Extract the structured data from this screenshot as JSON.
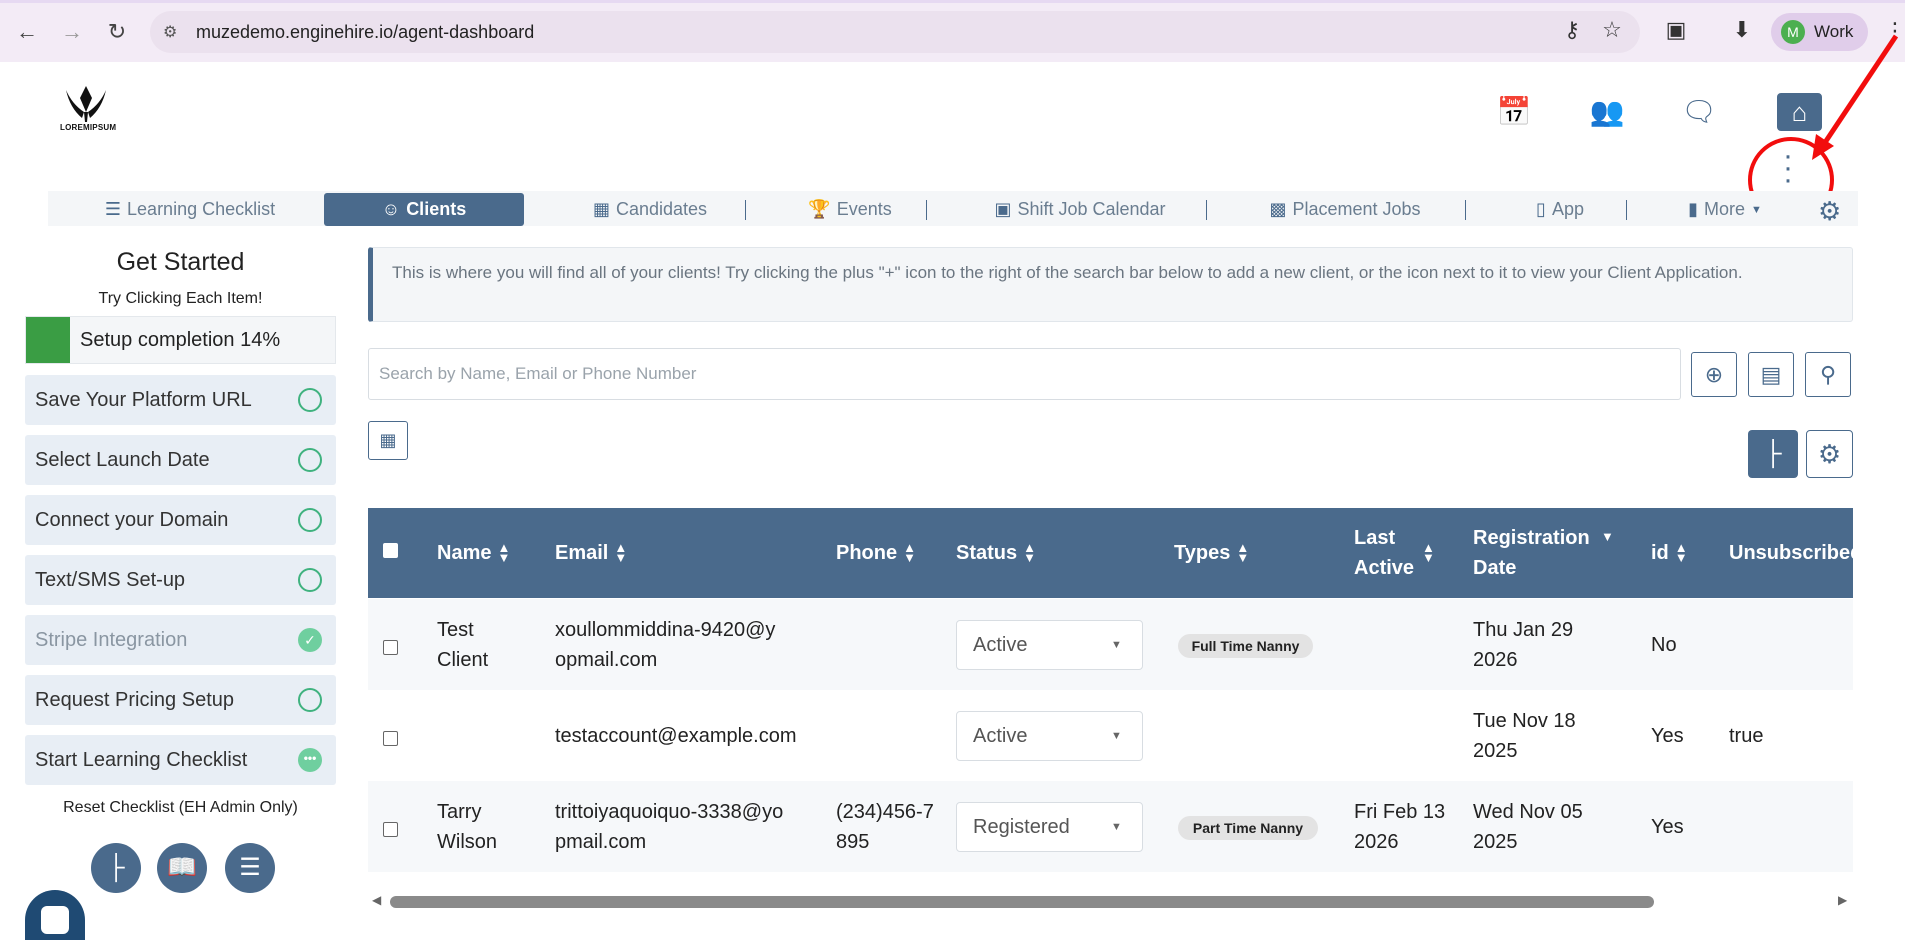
{
  "browser": {
    "url": "muzedemo.enginehire.io/agent-dashboard",
    "profile_initial": "M",
    "profile_name": "Work"
  },
  "header": {
    "logo_text": "LOREMIPSUM"
  },
  "tabs": [
    {
      "label": "Learning Checklist",
      "icon": "checklist-icon"
    },
    {
      "label": "Clients",
      "icon": "clients-icon",
      "active": true
    },
    {
      "label": "Candidates",
      "icon": "badge-icon"
    },
    {
      "label": "Events",
      "icon": "trophy-icon"
    },
    {
      "label": "Shift Job Calendar",
      "icon": "calendar-icon"
    },
    {
      "label": "Placement Jobs",
      "icon": "briefcase-icon"
    },
    {
      "label": "App",
      "icon": "phone-icon"
    },
    {
      "label": "More",
      "icon": "ticket-icon"
    }
  ],
  "sidebar": {
    "title": "Get Started",
    "subtitle": "Try Clicking Each Item!",
    "progress_label": "Setup completion 14%",
    "progress_percent": 14,
    "items": [
      {
        "label": "Save Your Platform URL",
        "state": "todo"
      },
      {
        "label": "Select Launch Date",
        "state": "todo"
      },
      {
        "label": "Connect your Domain",
        "state": "todo"
      },
      {
        "label": "Text/SMS Set-up",
        "state": "todo"
      },
      {
        "label": "Stripe Integration",
        "state": "done"
      },
      {
        "label": "Request Pricing Setup",
        "state": "todo"
      },
      {
        "label": "Start Learning Checklist",
        "state": "in-progress"
      }
    ],
    "reset_label": "Reset Checklist (EH Admin Only)"
  },
  "main": {
    "info_text": "This is where you will find all of your clients! Try clicking the plus \"+\" icon to the right of the search bar below to add a new client, or the icon next to it to view your Client Application.",
    "search_placeholder": "Search by Name, Email or Phone Number",
    "table": {
      "headers": {
        "name": "Name",
        "email": "Email",
        "phone": "Phone",
        "status": "Status",
        "types": "Types",
        "last_active": "Last Active",
        "registration_date": "Registration Date",
        "id": "id",
        "unsubscribed": "Unsubscribed"
      },
      "rows": [
        {
          "name": "Test Client",
          "email": "xoullommiddina-9420@yopmail.com",
          "phone": "",
          "status": "Active",
          "type": "Full Time Nanny",
          "last_active": "",
          "registration_date": "Thu Jan 29 2026",
          "id": "No",
          "unsubscribed": ""
        },
        {
          "name": "",
          "email": "testaccount@example.com",
          "phone": "",
          "status": "Active",
          "type": "",
          "last_active": "",
          "registration_date": "Tue Nov 18 2025",
          "id": "Yes",
          "unsubscribed": "true"
        },
        {
          "name": "Tarry Wilson",
          "email": "trittoiyaquoiquo-3338@yopmail.com",
          "phone": "(234)456-7895",
          "status": "Registered",
          "type": "Part Time Nanny",
          "last_active": "Fri Feb 13 2026",
          "registration_date": "Wed Nov 05 2025",
          "id": "Yes",
          "unsubscribed": ""
        }
      ]
    }
  },
  "colors": {
    "primary": "#4a6a8c",
    "success": "#3a9d44",
    "annotation": "#f20d0d"
  }
}
